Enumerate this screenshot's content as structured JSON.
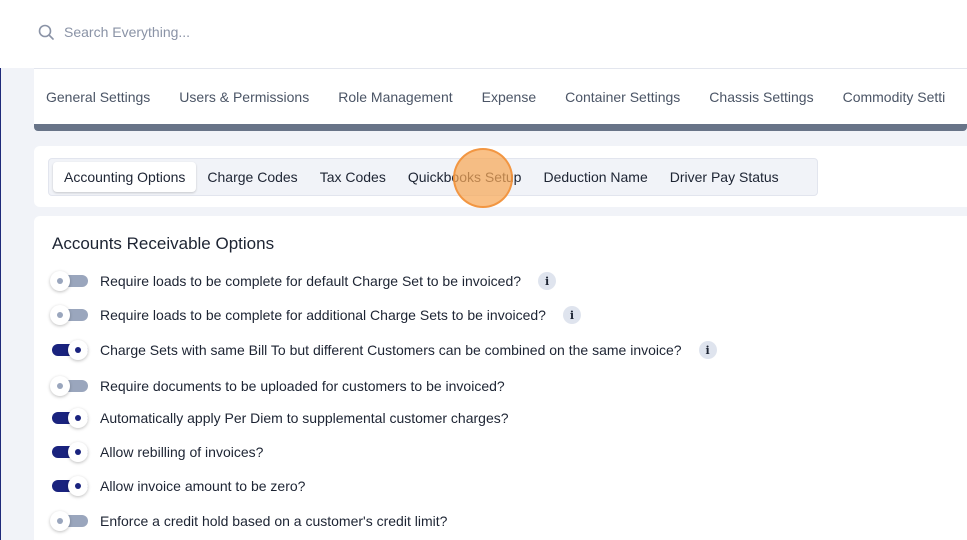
{
  "search": {
    "placeholder": "Search Everything...",
    "icon": "search-icon"
  },
  "settings_nav": {
    "items": [
      "General Settings",
      "Users & Permissions",
      "Role Management",
      "Expense",
      "Container Settings",
      "Chassis Settings",
      "Commodity Setti"
    ]
  },
  "billing_tabs": {
    "active": "Accounting Options",
    "items": [
      "Accounting Options",
      "Charge Codes",
      "Tax Codes",
      "Quickbooks Setup",
      "Deduction Name",
      "Driver Pay Status"
    ]
  },
  "accounts_receivable": {
    "title": "Accounts Receivable Options",
    "options": [
      {
        "label": "Require loads to be complete for default Charge Set to be invoiced?",
        "enabled": false,
        "info": "i"
      },
      {
        "label": "Require loads to be complete for additional Charge Sets to be invoiced?",
        "enabled": false,
        "info": "i"
      },
      {
        "label": "Charge Sets with same Bill To but different Customers can be combined on the same invoice?",
        "enabled": true,
        "info": "i"
      },
      {
        "label": "Require documents to be uploaded for customers to be invoiced?",
        "enabled": false
      },
      {
        "label": "Automatically apply Per Diem to supplemental customer charges?",
        "enabled": true
      },
      {
        "label": "Allow rebilling of invoices?",
        "enabled": true
      },
      {
        "label": "Allow invoice amount to be zero?",
        "enabled": true
      },
      {
        "label": "Enforce a credit hold based on a customer's credit limit?",
        "enabled": false
      }
    ]
  },
  "colors": {
    "toggle_on": "#1a237e",
    "toggle_off": "#9aa6bd",
    "click_highlight": "#f7a857"
  }
}
